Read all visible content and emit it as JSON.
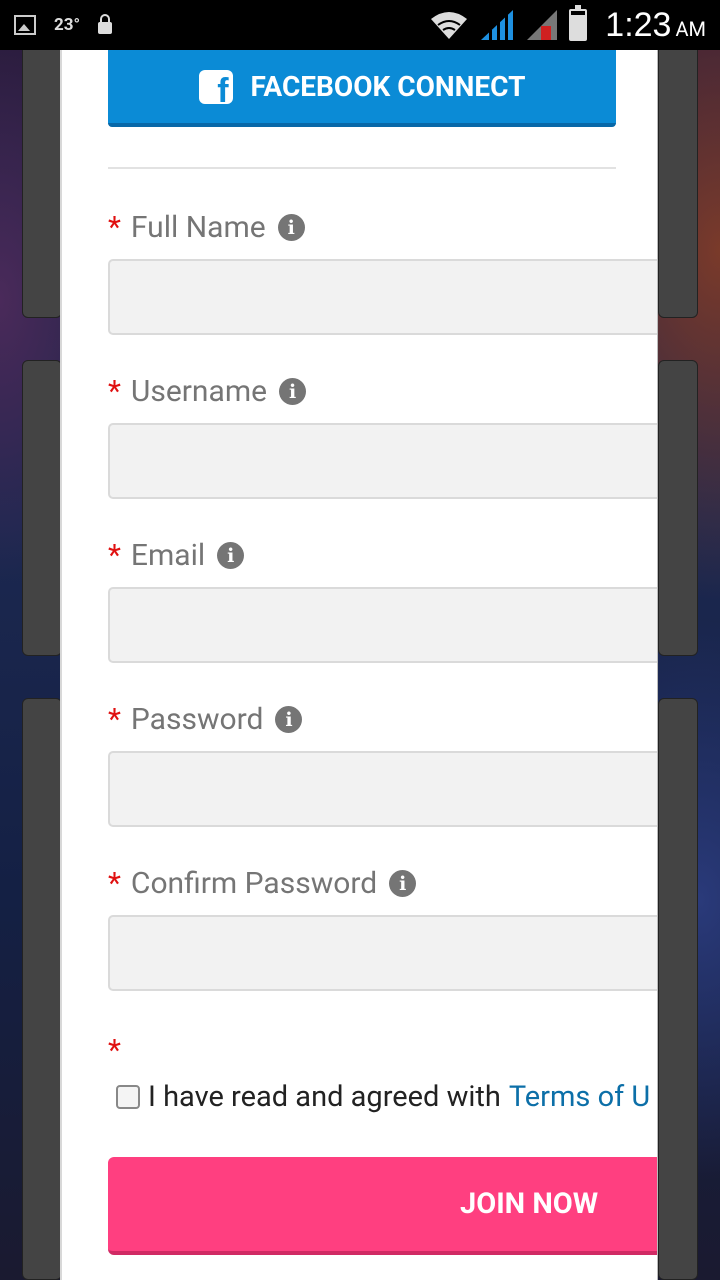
{
  "status_bar": {
    "temperature": "23°",
    "time": "1:23",
    "ampm": "AM",
    "icons": [
      "image-icon",
      "lock-icon",
      "wifi-icon",
      "signal-icon",
      "signal-no-sim-icon",
      "battery-icon"
    ]
  },
  "facebook": {
    "label": "FACEBOOK CONNECT",
    "icon": "facebook-icon",
    "color": "#0b8bd6"
  },
  "fields": [
    {
      "label": "Full Name",
      "value": "",
      "required": true
    },
    {
      "label": "Username",
      "value": "",
      "required": true
    },
    {
      "label": "Email",
      "value": "",
      "required": true
    },
    {
      "label": "Password",
      "value": "",
      "required": true
    },
    {
      "label": "Confirm Password",
      "value": "",
      "required": true
    }
  ],
  "required_marker": "*",
  "info_glyph": "i",
  "terms": {
    "checked": false,
    "text": "I have read and agreed with",
    "link": "Terms of U"
  },
  "join_button": {
    "label": "JOIN NOW",
    "color": "#ff3f80"
  }
}
